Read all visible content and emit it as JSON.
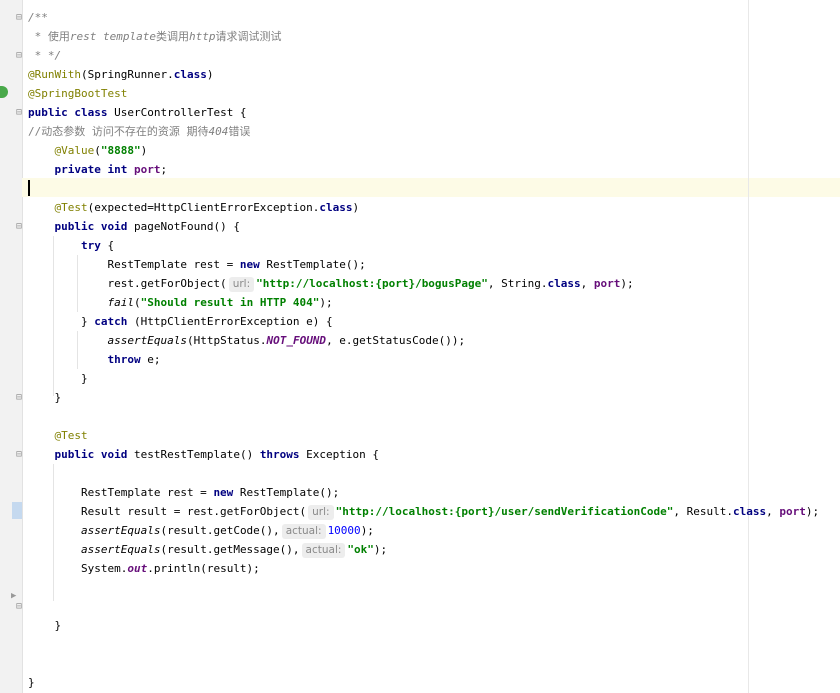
{
  "editor": {
    "lines": [
      {
        "tokens": [
          {
            "t": "/**",
            "c": "cmt"
          }
        ]
      },
      {
        "tokens": [
          {
            "t": " * ",
            "c": "cmt"
          },
          {
            "t": "使用",
            "c": "cmtcn"
          },
          {
            "t": "rest template",
            "c": "cmt"
          },
          {
            "t": "类调用",
            "c": "cmtcn"
          },
          {
            "t": "http",
            "c": "cmt"
          },
          {
            "t": "请求调试测试",
            "c": "cmtcn"
          }
        ]
      },
      {
        "tokens": [
          {
            "t": " * */",
            "c": "cmt"
          }
        ]
      },
      {
        "tokens": [
          {
            "t": "@RunWith",
            "c": "ann"
          },
          {
            "t": "(SpringRunner."
          },
          {
            "t": "class",
            "c": "kw"
          },
          {
            "t": ")"
          }
        ]
      },
      {
        "tokens": [
          {
            "t": "@SpringBootTest",
            "c": "ann"
          }
        ]
      },
      {
        "tokens": [
          {
            "t": "public class",
            "c": "kw"
          },
          {
            "t": " UserControllerTest {"
          }
        ]
      },
      {
        "tokens": [
          {
            "t": "//动态参数 访问不存在的资源 期待",
            "c": "cmtcn"
          },
          {
            "t": "404",
            "c": "cmt"
          },
          {
            "t": "错误",
            "c": "cmtcn"
          }
        ]
      },
      {
        "tokens": [
          {
            "t": "    "
          },
          {
            "t": "@Value",
            "c": "ann"
          },
          {
            "t": "("
          },
          {
            "t": "\"8888\"",
            "c": "str"
          },
          {
            "t": ")"
          }
        ]
      },
      {
        "tokens": [
          {
            "t": "    "
          },
          {
            "t": "private int",
            "c": "kw"
          },
          {
            "t": " "
          },
          {
            "t": "port",
            "c": "fld"
          },
          {
            "t": ";"
          }
        ]
      },
      {
        "tokens": []
      },
      {
        "tokens": [
          {
            "t": "    "
          },
          {
            "t": "@Test",
            "c": "ann"
          },
          {
            "t": "(expected=HttpClientErrorException."
          },
          {
            "t": "class",
            "c": "kw"
          },
          {
            "t": ")"
          }
        ]
      },
      {
        "tokens": [
          {
            "t": "    "
          },
          {
            "t": "public void",
            "c": "kw"
          },
          {
            "t": " pageNotFound() {"
          }
        ]
      },
      {
        "tokens": [
          {
            "t": "        "
          },
          {
            "t": "try",
            "c": "kw"
          },
          {
            "t": " {"
          }
        ]
      },
      {
        "tokens": [
          {
            "t": "            RestTemplate rest = "
          },
          {
            "t": "new",
            "c": "kw"
          },
          {
            "t": " RestTemplate();"
          }
        ]
      },
      {
        "tokens": [
          {
            "t": "            rest.getForObject("
          },
          {
            "t": "url:",
            "c": "hint"
          },
          {
            "t": "\"http://localhost:{port}/bogusPage\"",
            "c": "str"
          },
          {
            "t": ", String."
          },
          {
            "t": "class",
            "c": "kw"
          },
          {
            "t": ", "
          },
          {
            "t": "port",
            "c": "fld"
          },
          {
            "t": ");"
          }
        ]
      },
      {
        "tokens": [
          {
            "t": "            "
          },
          {
            "t": "fail",
            "c": "static"
          },
          {
            "t": "("
          },
          {
            "t": "\"Should result in HTTP 404\"",
            "c": "str"
          },
          {
            "t": ");"
          }
        ]
      },
      {
        "tokens": [
          {
            "t": "        } "
          },
          {
            "t": "catch",
            "c": "kw"
          },
          {
            "t": " (HttpClientErrorException e) {"
          }
        ]
      },
      {
        "tokens": [
          {
            "t": "            "
          },
          {
            "t": "assertEquals",
            "c": "static"
          },
          {
            "t": "(HttpStatus."
          },
          {
            "t": "NOT_FOUND",
            "c": "sf"
          },
          {
            "t": ", e.getStatusCode());"
          }
        ]
      },
      {
        "tokens": [
          {
            "t": "            "
          },
          {
            "t": "throw",
            "c": "kw"
          },
          {
            "t": " e;"
          }
        ]
      },
      {
        "tokens": [
          {
            "t": "        }"
          }
        ]
      },
      {
        "tokens": [
          {
            "t": "    }"
          }
        ]
      },
      {
        "tokens": []
      },
      {
        "tokens": [
          {
            "t": "    "
          },
          {
            "t": "@Test",
            "c": "ann"
          }
        ]
      },
      {
        "tokens": [
          {
            "t": "    "
          },
          {
            "t": "public void",
            "c": "kw"
          },
          {
            "t": " testRestTemplate() "
          },
          {
            "t": "throws",
            "c": "kw"
          },
          {
            "t": " Exception {"
          }
        ]
      },
      {
        "tokens": []
      },
      {
        "tokens": [
          {
            "t": "        RestTemplate rest = "
          },
          {
            "t": "new",
            "c": "kw"
          },
          {
            "t": " RestTemplate();"
          }
        ]
      },
      {
        "tokens": [
          {
            "t": "        Result result = rest.getForObject("
          },
          {
            "t": "url:",
            "c": "hint"
          },
          {
            "t": "\"http://localhost:{port}/user/sendVerificationCode\"",
            "c": "str"
          },
          {
            "t": ", Result."
          },
          {
            "t": "class",
            "c": "kw"
          },
          {
            "t": ", "
          },
          {
            "t": "port",
            "c": "fld"
          },
          {
            "t": ");"
          }
        ]
      },
      {
        "tokens": [
          {
            "t": "        "
          },
          {
            "t": "assertEquals",
            "c": "static"
          },
          {
            "t": "(result.getCode(),"
          },
          {
            "t": "actual:",
            "c": "hint"
          },
          {
            "t": "10000",
            "c": "num"
          },
          {
            "t": ");"
          }
        ]
      },
      {
        "tokens": [
          {
            "t": "        "
          },
          {
            "t": "assertEquals",
            "c": "static"
          },
          {
            "t": "(result.getMessage(),"
          },
          {
            "t": "actual:",
            "c": "hint"
          },
          {
            "t": "\"ok\"",
            "c": "str"
          },
          {
            "t": ");"
          }
        ]
      },
      {
        "tokens": [
          {
            "t": "        System."
          },
          {
            "t": "out",
            "c": "sf"
          },
          {
            "t": ".println(result);"
          }
        ]
      },
      {
        "tokens": []
      },
      {
        "tokens": []
      },
      {
        "tokens": [
          {
            "t": "    }"
          }
        ]
      },
      {
        "tokens": []
      },
      {
        "tokens": []
      },
      {
        "tokens": [
          {
            "t": "}"
          }
        ]
      }
    ]
  },
  "gutter_icons": [
    {
      "name": "fold-icon",
      "glyph": "⊟"
    },
    {
      "name": "run-test-icon",
      "glyph": "▶"
    }
  ]
}
